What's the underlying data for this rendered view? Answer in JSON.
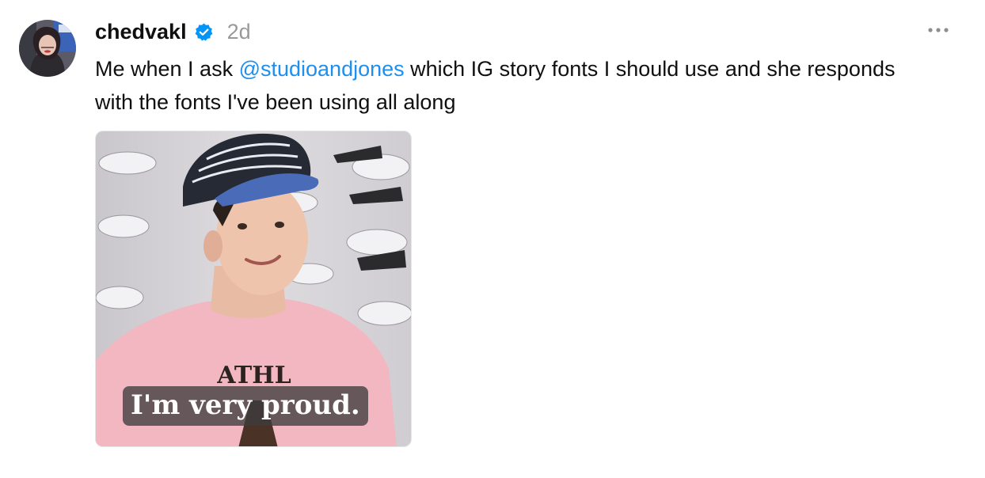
{
  "post": {
    "username": "chedvakl",
    "verified_icon": "verified-badge-icon",
    "timestamp": "2d",
    "more_icon": "more-options-icon",
    "caption": {
      "before_mention": "Me when I ask ",
      "mention": "@studioandjones",
      "after_mention": " which IG story fonts I should use and she responds with the fonts I've been using all along"
    },
    "media": {
      "subtitle": "I'm very proud.",
      "shirt_text": "ATHL"
    }
  },
  "colors": {
    "link": "#1d8ff0",
    "verified": "#0095f6",
    "secondary_text": "#999999",
    "primary_text": "#101010"
  }
}
